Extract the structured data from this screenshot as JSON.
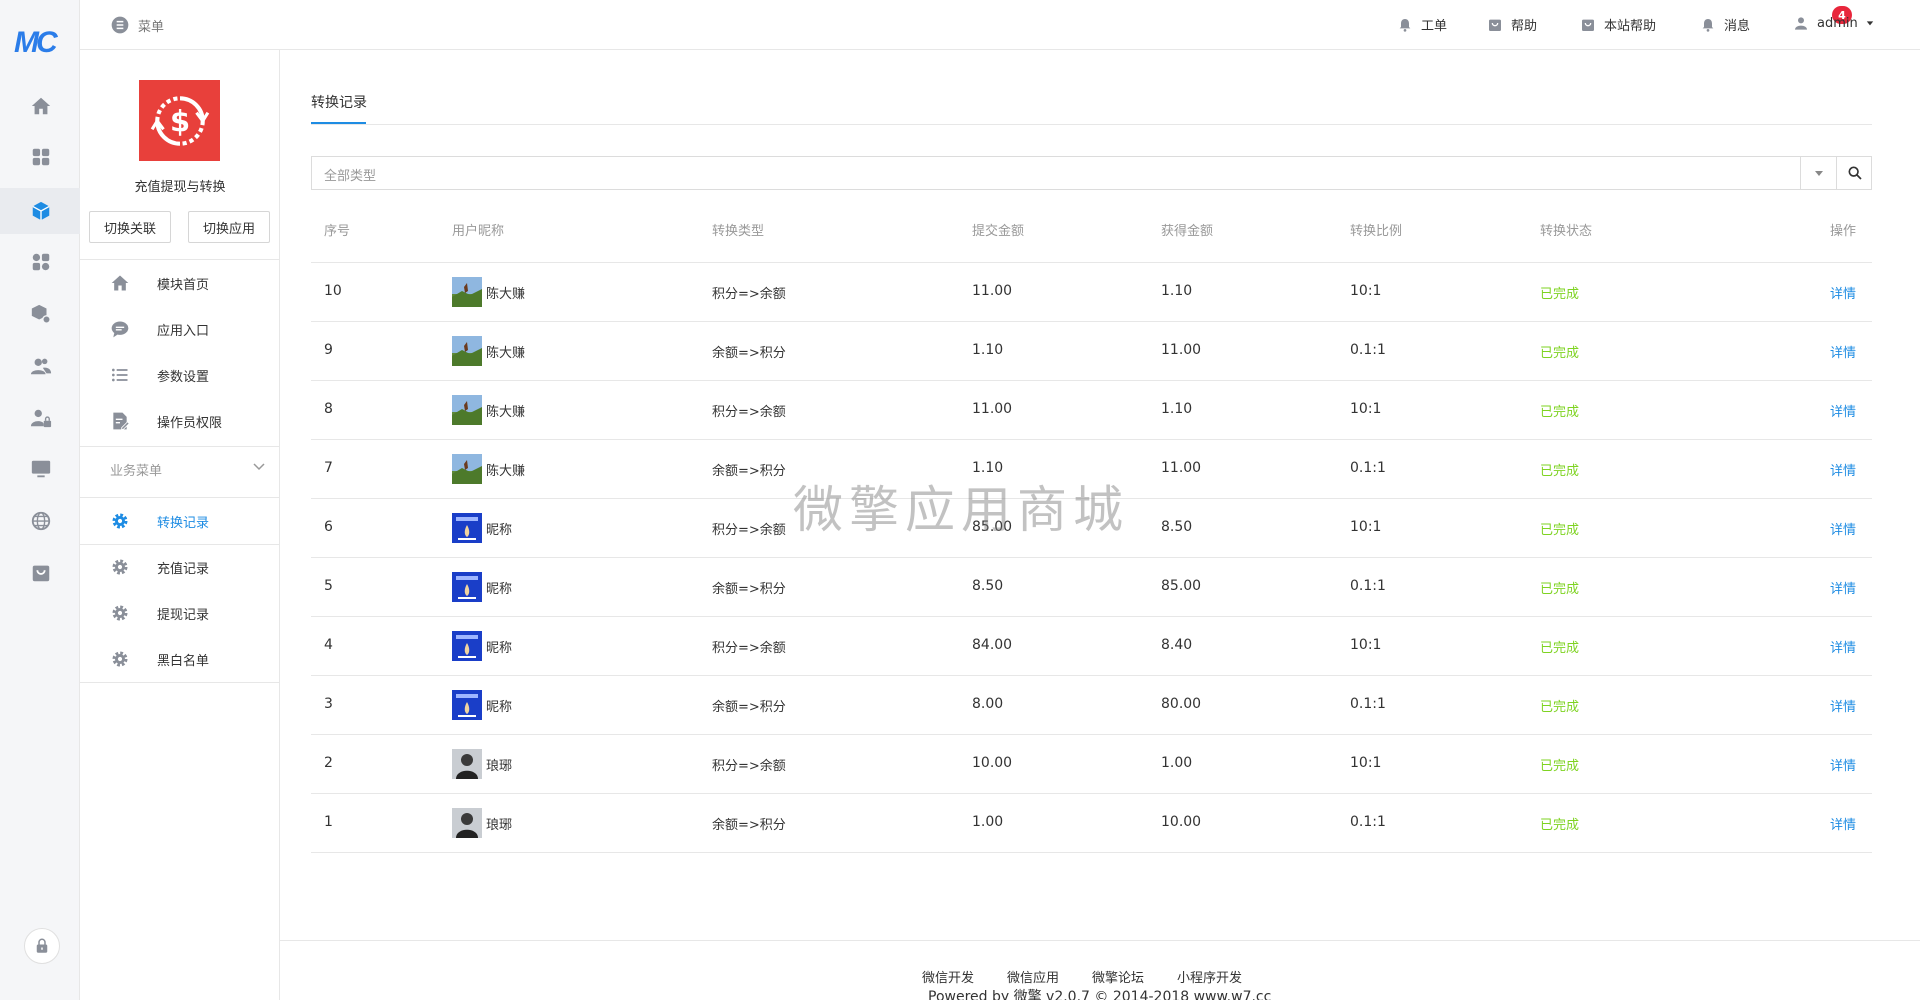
{
  "brand": {
    "logo_text": "MC",
    "accent": "#1e8ce3",
    "logo_color": "#2b7de9"
  },
  "topbar": {
    "menu_label": "菜单",
    "items": [
      {
        "label": "工单",
        "icon": "bell-icon"
      },
      {
        "label": "帮助",
        "icon": "shopping-bag-icon"
      },
      {
        "label": "本站帮助",
        "icon": "shopping-bag-icon"
      },
      {
        "label": "消息",
        "icon": "bell-icon"
      }
    ],
    "message_badge": "4",
    "user": "admin"
  },
  "rail": {
    "icons": [
      "home-icon",
      "apps-grid-icon",
      "cube-icon",
      "modules-icon",
      "package-settings-icon",
      "users-icon",
      "user-lock-icon",
      "monitor-icon",
      "globe-icon",
      "store-icon"
    ],
    "active_index": 2
  },
  "sidebar": {
    "app_name": "充值提现与转换",
    "app_logo_color": "#e8403b",
    "buttons": {
      "switch_link": "切换关联",
      "switch_app": "切换应用"
    },
    "items": [
      {
        "label": "模块首页",
        "icon": "home-icon"
      },
      {
        "label": "应用入口",
        "icon": "chat-icon"
      },
      {
        "label": "参数设置",
        "icon": "list-icon"
      },
      {
        "label": "操作员权限",
        "icon": "edit-doc-icon"
      }
    ],
    "business_header": "业务菜单",
    "business_items": [
      {
        "label": "转换记录",
        "icon": "gear-icon",
        "active": true
      },
      {
        "label": "充值记录",
        "icon": "gear-icon"
      },
      {
        "label": "提现记录",
        "icon": "gear-icon"
      },
      {
        "label": "黑白名单",
        "icon": "gear-icon"
      }
    ]
  },
  "main": {
    "tab": "转换记录",
    "filter_placeholder": "全部类型",
    "columns": [
      "序号",
      "用户昵称",
      "转换类型",
      "提交金额",
      "获得金额",
      "转换比例",
      "转换状态",
      "操作"
    ],
    "rows": [
      {
        "id": "10",
        "user": "陈大赚",
        "type": "积分=>余额",
        "submit": "11.00",
        "get": "1.10",
        "ratio": "10:1",
        "status": "已完成",
        "op": "详情",
        "avatar": "landscape"
      },
      {
        "id": "9",
        "user": "陈大赚",
        "type": "余额=>积分",
        "submit": "1.10",
        "get": "11.00",
        "ratio": "0.1:1",
        "status": "已完成",
        "op": "详情",
        "avatar": "landscape"
      },
      {
        "id": "8",
        "user": "陈大赚",
        "type": "积分=>余额",
        "submit": "11.00",
        "get": "1.10",
        "ratio": "10:1",
        "status": "已完成",
        "op": "详情",
        "avatar": "landscape"
      },
      {
        "id": "7",
        "user": "陈大赚",
        "type": "余额=>积分",
        "submit": "1.10",
        "get": "11.00",
        "ratio": "0.1:1",
        "status": "已完成",
        "op": "详情",
        "avatar": "landscape"
      },
      {
        "id": "6",
        "user": "昵称",
        "type": "积分=>余额",
        "submit": "85.00",
        "get": "8.50",
        "ratio": "10:1",
        "status": "已完成",
        "op": "详情",
        "avatar": "blue"
      },
      {
        "id": "5",
        "user": "昵称",
        "type": "余额=>积分",
        "submit": "8.50",
        "get": "85.00",
        "ratio": "0.1:1",
        "status": "已完成",
        "op": "详情",
        "avatar": "blue"
      },
      {
        "id": "4",
        "user": "昵称",
        "type": "积分=>余额",
        "submit": "84.00",
        "get": "8.40",
        "ratio": "10:1",
        "status": "已完成",
        "op": "详情",
        "avatar": "blue"
      },
      {
        "id": "3",
        "user": "昵称",
        "type": "余额=>积分",
        "submit": "8.00",
        "get": "80.00",
        "ratio": "0.1:1",
        "status": "已完成",
        "op": "详情",
        "avatar": "blue"
      },
      {
        "id": "2",
        "user": "琅琊",
        "type": "积分=>余额",
        "submit": "10.00",
        "get": "1.00",
        "ratio": "10:1",
        "status": "已完成",
        "op": "详情",
        "avatar": "person"
      },
      {
        "id": "1",
        "user": "琅琊",
        "type": "余额=>积分",
        "submit": "1.00",
        "get": "10.00",
        "ratio": "0.1:1",
        "status": "已完成",
        "op": "详情",
        "avatar": "person"
      }
    ],
    "status_color": "#7ed321"
  },
  "watermark": "微擎应用商城",
  "footer": {
    "links": [
      "微信开发",
      "微信应用",
      "微擎论坛",
      "小程序开发"
    ],
    "copyright": "Powered by 微擎 v2.0.7 © 2014-2018 www.w7.cc"
  }
}
